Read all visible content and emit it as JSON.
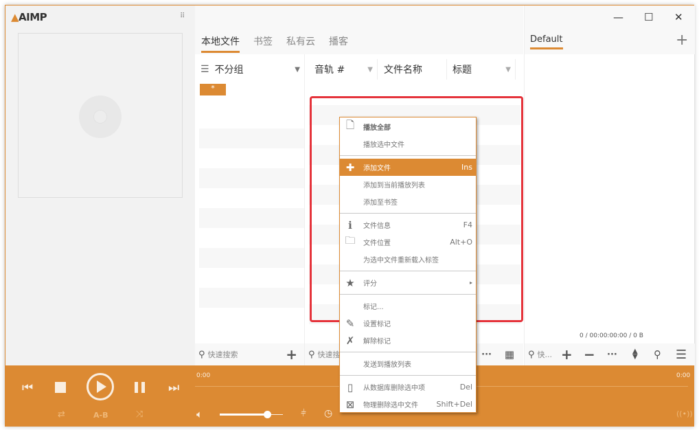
{
  "app": {
    "logo": "AIMP"
  },
  "window": {
    "minimize": "—",
    "maximize": "☐",
    "close": "✕"
  },
  "library": {
    "tabs": [
      "本地文件",
      "书签",
      "私有云",
      "播客"
    ],
    "group_label": "不分组",
    "group_item": "*",
    "columns": [
      "音轨 #",
      "文件名称",
      "标题"
    ],
    "search_placeholder": "快速搜索",
    "search_placeholder_short": "快速搜"
  },
  "playlist": {
    "tab": "Default",
    "add": "+",
    "summary": "0 / 00:00:00:00 / 0 B",
    "search_placeholder": "快..."
  },
  "player": {
    "time_left": "0:00",
    "time_right": "0:00",
    "ab_label": "A-B",
    "volume": 0.75
  },
  "context_menu": {
    "groups": [
      [
        {
          "icon": "play-file-icon",
          "label": "播放全部",
          "bold": true
        },
        {
          "label": "播放选中文件"
        }
      ],
      [
        {
          "icon": "plus-icon",
          "label": "添加文件",
          "shortcut": "Ins",
          "highlight": true
        },
        {
          "label": "添加到当前播放列表"
        },
        {
          "label": "添加至书签"
        }
      ],
      [
        {
          "icon": "info-icon",
          "label": "文件信息",
          "shortcut": "F4"
        },
        {
          "icon": "folder-icon",
          "label": "文件位置",
          "shortcut": "Alt+O"
        },
        {
          "label": "为选中文件重新载入标签"
        }
      ],
      [
        {
          "icon": "star-icon",
          "label": "评分",
          "submenu": "▸"
        }
      ],
      [
        {
          "label": "标记..."
        },
        {
          "icon": "pin-icon",
          "label": "设置标记"
        },
        {
          "icon": "pin-remove-icon",
          "label": "解除标记"
        }
      ],
      [
        {
          "label": "发送到播放列表"
        }
      ],
      [
        {
          "icon": "delete-db-icon",
          "label": "从数据库删除选中项",
          "shortcut": "Del"
        },
        {
          "icon": "delete-file-icon",
          "label": "物理删除选中文件",
          "shortcut": "Shift+Del"
        }
      ]
    ]
  },
  "colors": {
    "accent": "#dc8a33",
    "highlight_box": "#e5333b"
  }
}
